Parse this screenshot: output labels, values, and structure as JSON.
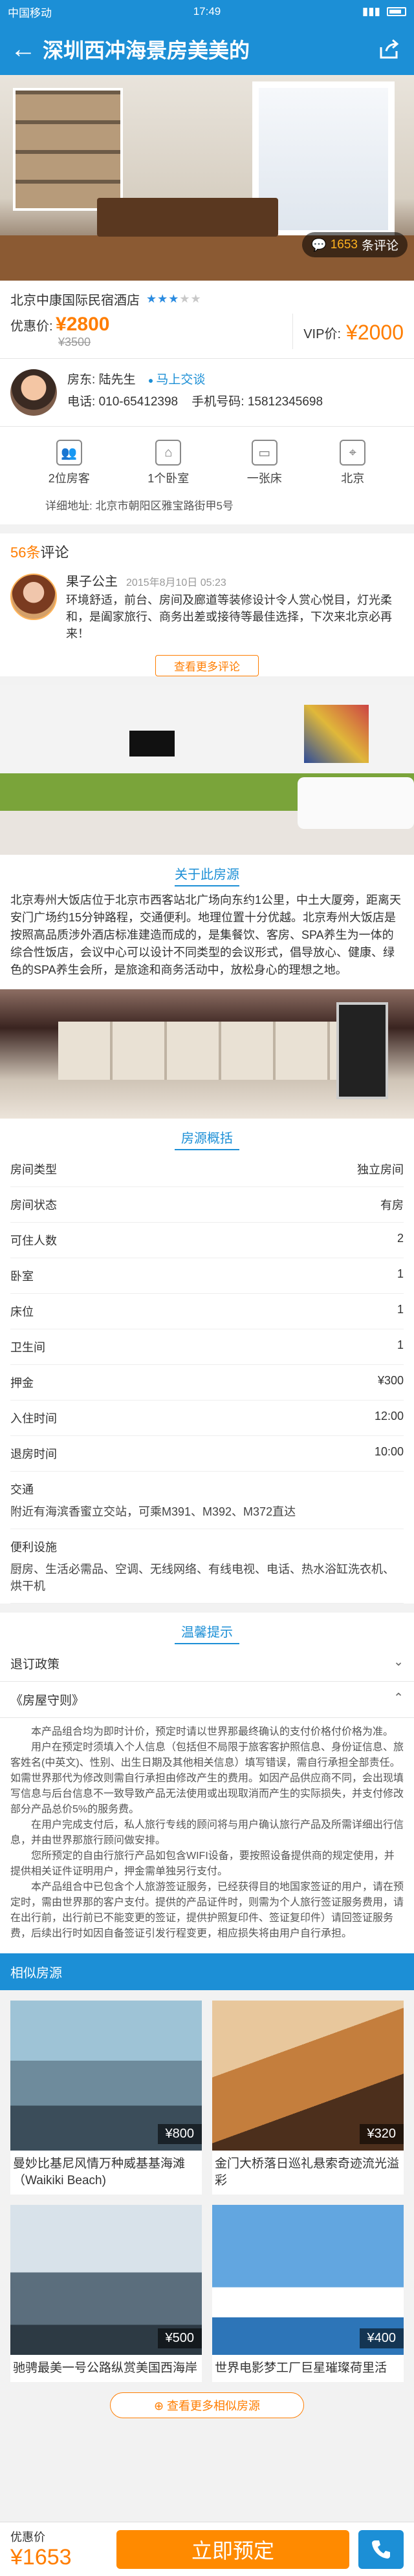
{
  "status": {
    "carrier": "中国移动",
    "time": "17:49"
  },
  "nav": {
    "title": "深圳西冲海景房美美的"
  },
  "hero": {
    "review_count": "1653",
    "review_suffix": "条评论"
  },
  "listing": {
    "hotel_name": "北京中康国际民宿酒店",
    "stars": 3,
    "price_label": "优惠价:",
    "price": "¥2800",
    "old_price": "¥3500",
    "vip_label": "VIP价:",
    "vip_price": "¥2000"
  },
  "host": {
    "name_label": "房东:",
    "name": "陆先生",
    "chat": "马上交谈",
    "phone_label": "电话:",
    "phone": "010-65412398",
    "mobile_label": "手机号码:",
    "mobile": "15812345698"
  },
  "facts": [
    {
      "icon": "guests-icon",
      "label": "2位房客"
    },
    {
      "icon": "bedroom-icon",
      "label": "1个卧室"
    },
    {
      "icon": "bed-icon",
      "label": "一张床"
    },
    {
      "icon": "location-icon",
      "label": "北京"
    }
  ],
  "address": {
    "label": "详细地址:",
    "value": "北京市朝阳区雅宝路街甲5号"
  },
  "reviews": {
    "count": "56条",
    "title": "评论",
    "item": {
      "name": "果子公主",
      "date": "2015年8月10日 05:23",
      "text": "环境舒适，前台、房间及廊道等装修设计令人赏心悦目，灯光柔和，是阖家旅行、商务出差或接待等最佳选择，下次来北京必再来！"
    },
    "more": "查看更多评论"
  },
  "about": {
    "title": "关于此房源",
    "text": "北京寿州大饭店位于北京市西客站北广场向东约1公里，中土大厦旁，距离天安门广场约15分钟路程，交通便利。地理位置十分优越。北京寿州大饭店是按照高品质涉外酒店标准建造而成的，是集餐饮、客房、SPA养生为一体的综合性饭店，会议中心可以设计不同类型的会议形式，倡导放心、健康、绿色的SPA养生会所，是旅途和商务活动中，放松身心的理想之地。"
  },
  "overview": {
    "title": "房源概括",
    "rows": [
      {
        "k": "房间类型",
        "v": "独立房间"
      },
      {
        "k": "房间状态",
        "v": "有房"
      },
      {
        "k": "可住人数",
        "v": "2"
      },
      {
        "k": "卧室",
        "v": "1"
      },
      {
        "k": "床位",
        "v": "1"
      },
      {
        "k": "卫生间",
        "v": "1"
      },
      {
        "k": "押金",
        "v": "¥300"
      },
      {
        "k": "入住时间",
        "v": "12:00"
      },
      {
        "k": "退房时间",
        "v": "10:00"
      }
    ],
    "transport_label": "交通",
    "transport": "附近有海滨香蜜立交站，可乘M391、M392、M372直达",
    "amenities_label": "便利设施",
    "amenities": "厨房、生活必需品、空调、无线网络、有线电视、电话、热水浴缸洗衣机、烘干机"
  },
  "tips": {
    "title": "温馨提示",
    "refund": "退订政策",
    "rules": "《房屋守则》",
    "policy": [
      "本产品组合均为即时计价，预定时请以世界那最终确认的支付价格付价格为准。",
      "用户在预定时须填入个人信息（包括但不局限于旅客客护照信息、身份证信息、旅客姓名(中英文)、性别、出生日期及其他相关信息）填写错误，需自行承担全部责任。如需世界那代为修改则需自行承担由修改产生的费用。如因产品供应商不同，会出现填写信息与后台信息不一致导致产品无法使用或出现取消而产生的实际损失，并支付修改部分产品总价5%的服务费。",
      "在用户完成支付后，私人旅行专线的顾问将与用户确认旅行产品及所需详细出行信息，并由世界那旅行顾问做安排。",
      "您所预定的自由行旅行产品如包含WIFI设备，要按照设备提供商的规定使用，并提供相关证件证明用户，押金需单独另行支付。",
      "本产品组合中已包含个人旅游签证服务，已经获得目的地国家签证的用户，请在预定时，需由世界那的客户支付。提供的产品证件时，则需为个人旅行签证服务费用，请在出行前，出行前已不能变更的签证，提供护照复印件、签证复印件）请回签证服务费，后续出行时如因自备签证引发行程变更，相应损失将由用户自行承担。"
    ]
  },
  "related": {
    "title": "相似房源",
    "items": [
      {
        "caption": "曼妙比基尼风情万种威基基海滩（Waikiki Beach)",
        "price": "¥800"
      },
      {
        "caption": "金门大桥落日巡礼悬索奇迹流光溢彩",
        "price": "¥320"
      },
      {
        "caption": "驰骋最美一号公路纵赏美国西海岸",
        "price": "¥500"
      },
      {
        "caption": "世界电影梦工厂巨星璀璨荷里活",
        "price": "¥400"
      }
    ],
    "more": "查看更多相似房源"
  },
  "bottom": {
    "label": "优惠价",
    "price": "¥1653",
    "book": "立即预定"
  },
  "colors": {
    "primary": "#1c8fd6",
    "accent": "#ff7d00"
  }
}
